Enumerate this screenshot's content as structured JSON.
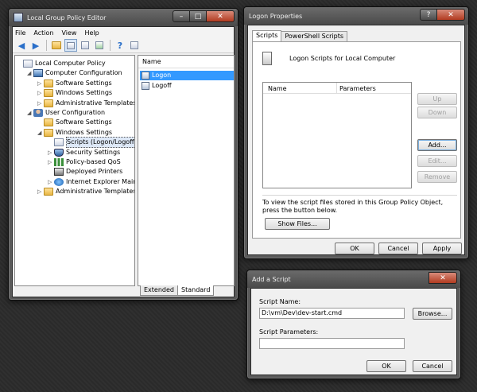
{
  "gpe": {
    "title": "Local Group Policy Editor",
    "menu": [
      "File",
      "Action",
      "View",
      "Help"
    ],
    "tree": [
      {
        "label": "Local Computer Policy",
        "indent": 0,
        "icon": "policy-icon",
        "exp": ""
      },
      {
        "label": "Computer Configuration",
        "indent": 1,
        "icon": "computer-icon",
        "exp": "◢"
      },
      {
        "label": "Software Settings",
        "indent": 2,
        "icon": "folder-icon",
        "exp": "▷"
      },
      {
        "label": "Windows Settings",
        "indent": 2,
        "icon": "folder-icon",
        "exp": "▷"
      },
      {
        "label": "Administrative Templates",
        "indent": 2,
        "icon": "folder-icon",
        "exp": "▷"
      },
      {
        "label": "User Configuration",
        "indent": 1,
        "icon": "user-icon",
        "exp": "◢"
      },
      {
        "label": "Software Settings",
        "indent": 2,
        "icon": "folder-icon",
        "exp": ""
      },
      {
        "label": "Windows Settings",
        "indent": 2,
        "icon": "folder-icon",
        "exp": "◢"
      },
      {
        "label": "Scripts (Logon/Logoff)",
        "indent": 3,
        "icon": "scripts-icon",
        "exp": "",
        "selected": true
      },
      {
        "label": "Security Settings",
        "indent": 3,
        "icon": "shield-icon",
        "exp": "▷"
      },
      {
        "label": "Policy-based QoS",
        "indent": 3,
        "icon": "chart-icon",
        "exp": "▷"
      },
      {
        "label": "Deployed Printers",
        "indent": 3,
        "icon": "printer-icon",
        "exp": ""
      },
      {
        "label": "Internet Explorer Mainten",
        "indent": 3,
        "icon": "ie-icon",
        "exp": "▷"
      },
      {
        "label": "Administrative Templates",
        "indent": 2,
        "icon": "folder-icon",
        "exp": "▷"
      }
    ],
    "list_header": "Name",
    "list_items": [
      {
        "label": "Logon",
        "selected": true
      },
      {
        "label": "Logoff",
        "selected": false
      }
    ],
    "bottom_tabs": [
      "Extended",
      "Standard"
    ]
  },
  "logon": {
    "title": "Logon Properties",
    "tabs": [
      "Scripts",
      "PowerShell Scripts"
    ],
    "heading": "Logon Scripts for Local Computer",
    "col_name": "Name",
    "col_params": "Parameters",
    "up": "Up",
    "down": "Down",
    "add": "Add...",
    "edit": "Edit...",
    "remove": "Remove",
    "info": "To view the script files stored in this Group Policy Object, press the button below.",
    "show_files": "Show Files...",
    "ok": "OK",
    "cancel": "Cancel",
    "apply": "Apply"
  },
  "add_script": {
    "title": "Add a Script",
    "name_label": "Script Name:",
    "name_value": "D:\\vm\\Dev\\dev-start.cmd",
    "browse": "Browse...",
    "params_label": "Script Parameters:",
    "params_value": "",
    "ok": "OK",
    "cancel": "Cancel"
  },
  "caption": {
    "minimize": "–",
    "maximize": "□",
    "close": "✕",
    "help": "?"
  }
}
